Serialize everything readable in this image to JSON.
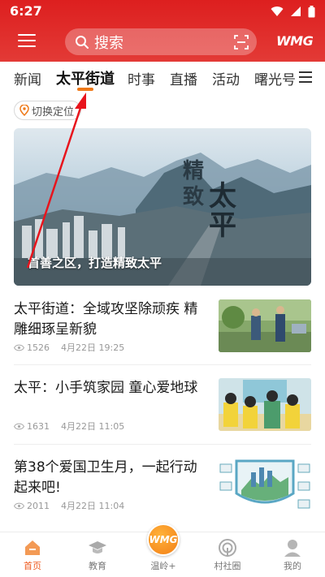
{
  "status": {
    "time": "6:27"
  },
  "header": {
    "search_placeholder": "搜索",
    "logo": "WMG",
    "accent": "#e02a28"
  },
  "tabs": [
    {
      "label": "新闻"
    },
    {
      "label": "太平街道"
    },
    {
      "label": "时事"
    },
    {
      "label": "直播"
    },
    {
      "label": "活动"
    },
    {
      "label": "曙光号"
    }
  ],
  "active_tab": "太平街道",
  "location_chip": {
    "label": "切换定位"
  },
  "banner": {
    "caption": "首善之区，打造精致太平",
    "art_text": [
      "精",
      "致",
      "太",
      "平"
    ]
  },
  "news": [
    {
      "title": "太平街道：全域攻坚除顽疾 精雕细琢呈新貌",
      "views": "1526",
      "date": "4月22日 19:25"
    },
    {
      "title": "太平：小手筑家园 童心爱地球",
      "views": "1631",
      "date": "4月22日 11:05"
    },
    {
      "title": "第38个爱国卫生月，一起行动起来吧!",
      "views": "2011",
      "date": "4月22日 11:04"
    }
  ],
  "bottom_nav": [
    {
      "label": "首页"
    },
    {
      "label": "教育"
    },
    {
      "label": "温岭+"
    },
    {
      "label": "村社圈"
    },
    {
      "label": "我的"
    }
  ],
  "bottom_center_logo": "WMG"
}
